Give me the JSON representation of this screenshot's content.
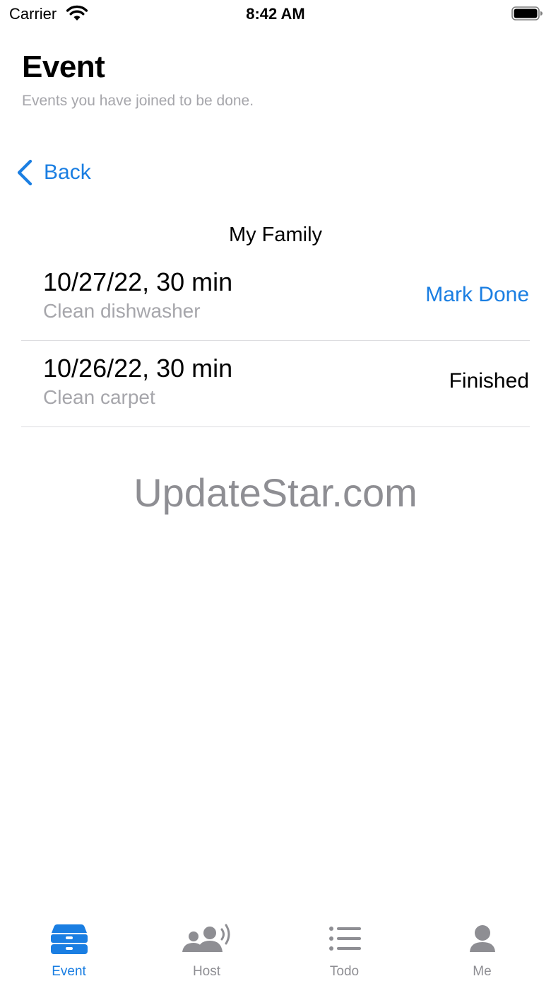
{
  "status_bar": {
    "carrier": "Carrier",
    "time": "8:42 AM"
  },
  "header": {
    "title": "Event",
    "subtitle": "Events you have joined to be done."
  },
  "back": {
    "label": "Back"
  },
  "section": {
    "title": "My Family"
  },
  "events": [
    {
      "date": "10/27/22, 30 min",
      "name": "Clean dishwasher",
      "action": "Mark Done"
    },
    {
      "date": "10/26/22, 30 min",
      "name": "Clean carpet",
      "action": "Finished"
    }
  ],
  "watermark": "UpdateStar.com",
  "tabs": [
    {
      "label": "Event",
      "icon": "tray-icon",
      "active": true
    },
    {
      "label": "Host",
      "icon": "people-broadcast-icon",
      "active": false
    },
    {
      "label": "Todo",
      "icon": "list-icon",
      "active": false
    },
    {
      "label": "Me",
      "icon": "person-icon",
      "active": false
    }
  ],
  "colors": {
    "accent": "#1a7ee2",
    "secondary_text": "#a6a6ab",
    "inactive_tab": "#8e8e93",
    "separator": "#dcdce0"
  }
}
